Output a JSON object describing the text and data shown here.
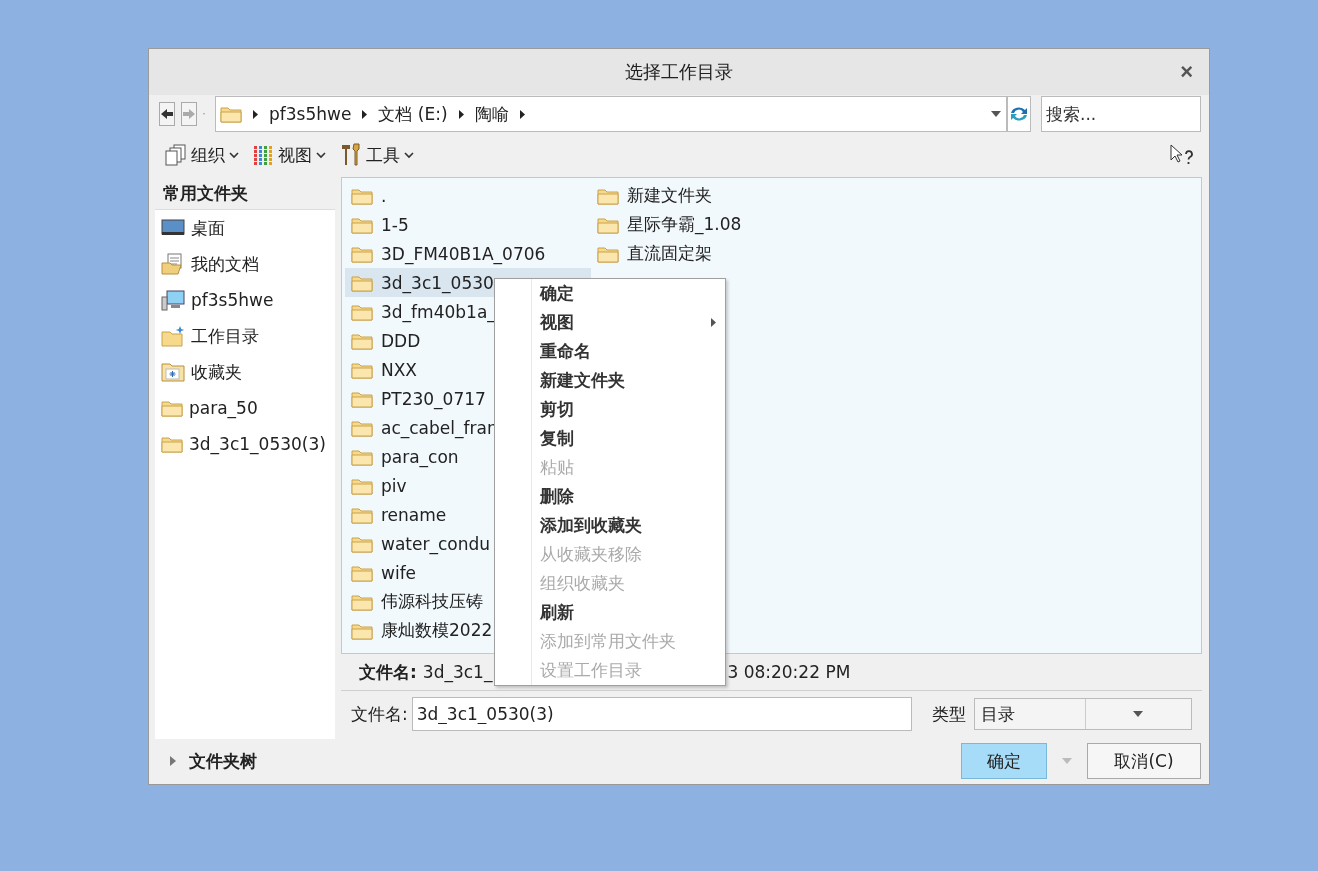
{
  "window": {
    "title": "选择工作目录",
    "close": "×"
  },
  "address_bar": {
    "path": [
      "pf3s5hwe",
      "文档 (E:)",
      "陶喻"
    ]
  },
  "search": {
    "placeholder": "搜索..."
  },
  "toolbar": [
    {
      "label": "组织",
      "kind": "organize"
    },
    {
      "label": "视图",
      "kind": "view"
    },
    {
      "label": "工具",
      "kind": "tools"
    }
  ],
  "sidebar": {
    "title": "常用文件夹",
    "items": [
      {
        "label": "桌面",
        "kind": "desktop"
      },
      {
        "label": "我的文档",
        "kind": "documents"
      },
      {
        "label": "pf3s5hwe",
        "kind": "computer"
      },
      {
        "label": "工作目录",
        "kind": "workdir"
      },
      {
        "label": "收藏夹",
        "kind": "favorites"
      },
      {
        "label": "para_50",
        "kind": "folder"
      },
      {
        "label": "3d_3c1_0530(3)",
        "kind": "folder"
      }
    ]
  },
  "files": {
    "columns": [
      [
        {
          "name": ".",
          "selected": false
        },
        {
          "name": "1-5",
          "selected": false
        },
        {
          "name": "3D_FM40B1A_0706",
          "selected": false
        },
        {
          "name": "3d_3c1_0530",
          "selected": true
        },
        {
          "name": "3d_fm40b1a_",
          "selected": false
        },
        {
          "name": "DDD",
          "selected": false
        },
        {
          "name": "NXX",
          "selected": false
        },
        {
          "name": "PT230_0717",
          "selected": false
        },
        {
          "name": "ac_cabel_fran",
          "selected": false
        },
        {
          "name": "para_con",
          "selected": false
        },
        {
          "name": "piv",
          "selected": false
        },
        {
          "name": "rename",
          "selected": false
        },
        {
          "name": "water_condu",
          "selected": false
        },
        {
          "name": "wife",
          "selected": false
        },
        {
          "name": "伟源科技压铸",
          "selected": false
        },
        {
          "name": "康灿数模2022",
          "selected": false
        }
      ],
      [
        {
          "name": "新建文件夹",
          "selected": false
        },
        {
          "name": "星际争霸_1.08",
          "selected": false
        },
        {
          "name": "直流固定架",
          "selected": false
        }
      ]
    ]
  },
  "context_menu": [
    {
      "label": "确定",
      "disabled": false,
      "submenu": false
    },
    {
      "label": "视图",
      "disabled": false,
      "submenu": true
    },
    {
      "label": "重命名",
      "disabled": false,
      "submenu": false
    },
    {
      "label": "新建文件夹",
      "disabled": false,
      "submenu": false
    },
    {
      "label": "剪切",
      "disabled": false,
      "submenu": false
    },
    {
      "label": "复制",
      "disabled": false,
      "submenu": false
    },
    {
      "label": "粘贴",
      "disabled": true,
      "submenu": false
    },
    {
      "label": "删除",
      "disabled": false,
      "submenu": false
    },
    {
      "label": "添加到收藏夹",
      "disabled": false,
      "submenu": false
    },
    {
      "label": "从收藏夹移除",
      "disabled": true,
      "submenu": false
    },
    {
      "label": "组织收藏夹",
      "disabled": true,
      "submenu": false
    },
    {
      "label": "刷新",
      "disabled": false,
      "submenu": false
    },
    {
      "label": "添加到常用文件夹",
      "disabled": true,
      "submenu": false
    },
    {
      "label": "设置工作目录",
      "disabled": true,
      "submenu": false
    }
  ],
  "status": {
    "label": "文件名:",
    "value": "3d_3c1_",
    "trailing": "3 08:20:22 PM"
  },
  "filename_field": {
    "label": "文件名:",
    "value": "3d_3c1_0530(3)"
  },
  "type_field": {
    "label": "类型",
    "value": "目录"
  },
  "folder_tree": {
    "label": "文件夹树",
    "expanded": false
  },
  "buttons": [
    {
      "label": "确定",
      "primary": true
    },
    {
      "label": "取消(C)",
      "primary": false
    }
  ]
}
